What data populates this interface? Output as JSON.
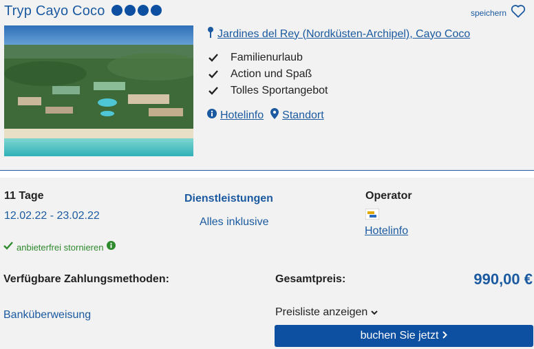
{
  "hotel": {
    "name": "Tryp Cayo Coco",
    "stars": 4,
    "save_label": "speichern",
    "location": "Jardines del Rey (Nordküsten-Archipel), Cayo Coco",
    "features": [
      "Familienurlaub",
      "Action und Spaß",
      "Tolles Sportangebot"
    ],
    "hotelinfo_label": "Hotelinfo",
    "standort_label": "Standort"
  },
  "offer": {
    "duration": "11 Tage",
    "dates": "12.02.22 - 23.02.22",
    "services_heading": "Dienstleistungen",
    "services_value": "Alles inklusive",
    "operator_heading": "Operator",
    "operator_link": "Hotelinfo",
    "cancellation": "anbieterfrei stornieren",
    "payment_heading": "Verfügbare Zahlungsmethoden:",
    "payment_method": "Banküberweisung",
    "total_label": "Gesamtpreis:",
    "total_price": "990,00 €",
    "pricelist_label": "Preisliste anzeigen",
    "book_label": "buchen Sie jetzt"
  },
  "colors": {
    "brand_blue": "#1b5aa0",
    "button_blue": "#0d4fa0",
    "success_green": "#2d8a2d"
  }
}
